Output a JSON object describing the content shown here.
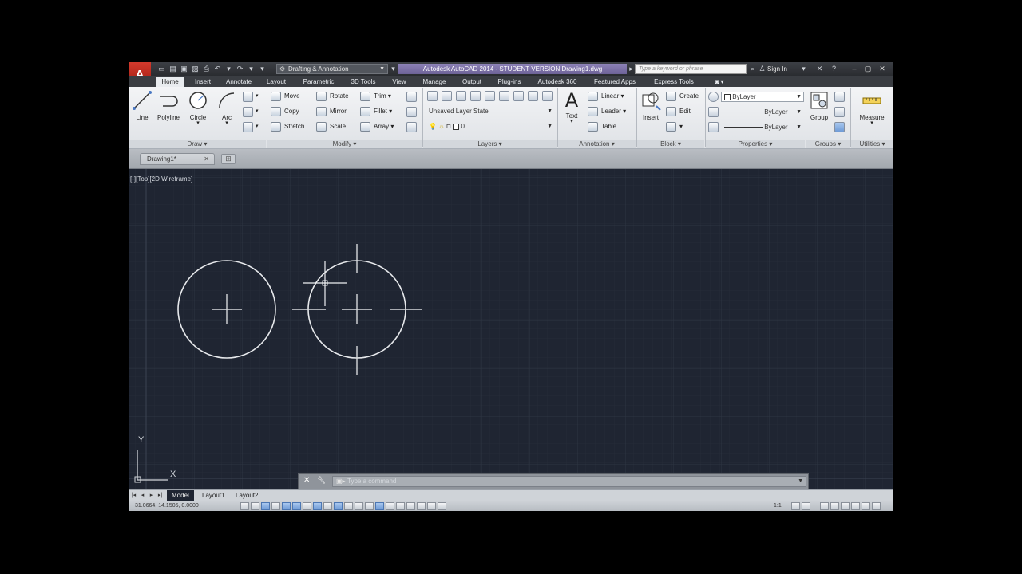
{
  "titlebar": {
    "logo": "A",
    "workspace": "Drafting & Annotation",
    "app_title": "Autodesk AutoCAD 2014 - STUDENT VERSION    Drawing1.dwg",
    "search_placeholder": "Type a keyword or phrase",
    "sign_in": "Sign In"
  },
  "ribbon_tabs": [
    "Home",
    "Insert",
    "Annotate",
    "Layout",
    "Parametric",
    "3D Tools",
    "View",
    "Manage",
    "Output",
    "Plug-ins",
    "Autodesk 360",
    "Featured Apps",
    "Express Tools"
  ],
  "ribbon": {
    "draw": {
      "label": "Draw",
      "buttons": [
        "Line",
        "Polyline",
        "Circle",
        "Arc"
      ]
    },
    "modify": {
      "label": "Modify",
      "buttons": [
        "Move",
        "Rotate",
        "Trim",
        "Copy",
        "Mirror",
        "Fillet",
        "Stretch",
        "Scale",
        "Array"
      ]
    },
    "layers": {
      "label": "Layers",
      "layer_state": "Unsaved Layer State",
      "current_layer": "0"
    },
    "annotation": {
      "label": "Annotation",
      "text_button": "Text",
      "buttons": [
        "Linear",
        "Leader",
        "Table"
      ]
    },
    "block": {
      "label": "Block",
      "insert_button": "Insert",
      "buttons": [
        "Create",
        "Edit"
      ]
    },
    "properties": {
      "label": "Properties",
      "color": "ByLayer",
      "lineweight": "ByLayer",
      "linetype": "ByLayer"
    },
    "groups": {
      "label": "Groups",
      "group_button": "Group"
    },
    "utilities": {
      "label": "Utilities",
      "measure_button": "Measure"
    }
  },
  "document": {
    "file_tab": "Drawing1*"
  },
  "viewport": {
    "controls": "[-][Top][2D Wireframe]"
  },
  "ucs": {
    "x_label": "X",
    "y_label": "Y"
  },
  "command_line": {
    "placeholder": "Type a command"
  },
  "layout_tabs": [
    "Model",
    "Layout1",
    "Layout2"
  ],
  "status_bar": {
    "coordinates": "31.0664, 14.1505, 0.0000",
    "annotation_scale": "1:1"
  },
  "colors": {
    "canvas": "#1f2532",
    "ribbon": "#e9ecef",
    "title_highlight": "#7f74aa",
    "logo": "#c7302a"
  }
}
